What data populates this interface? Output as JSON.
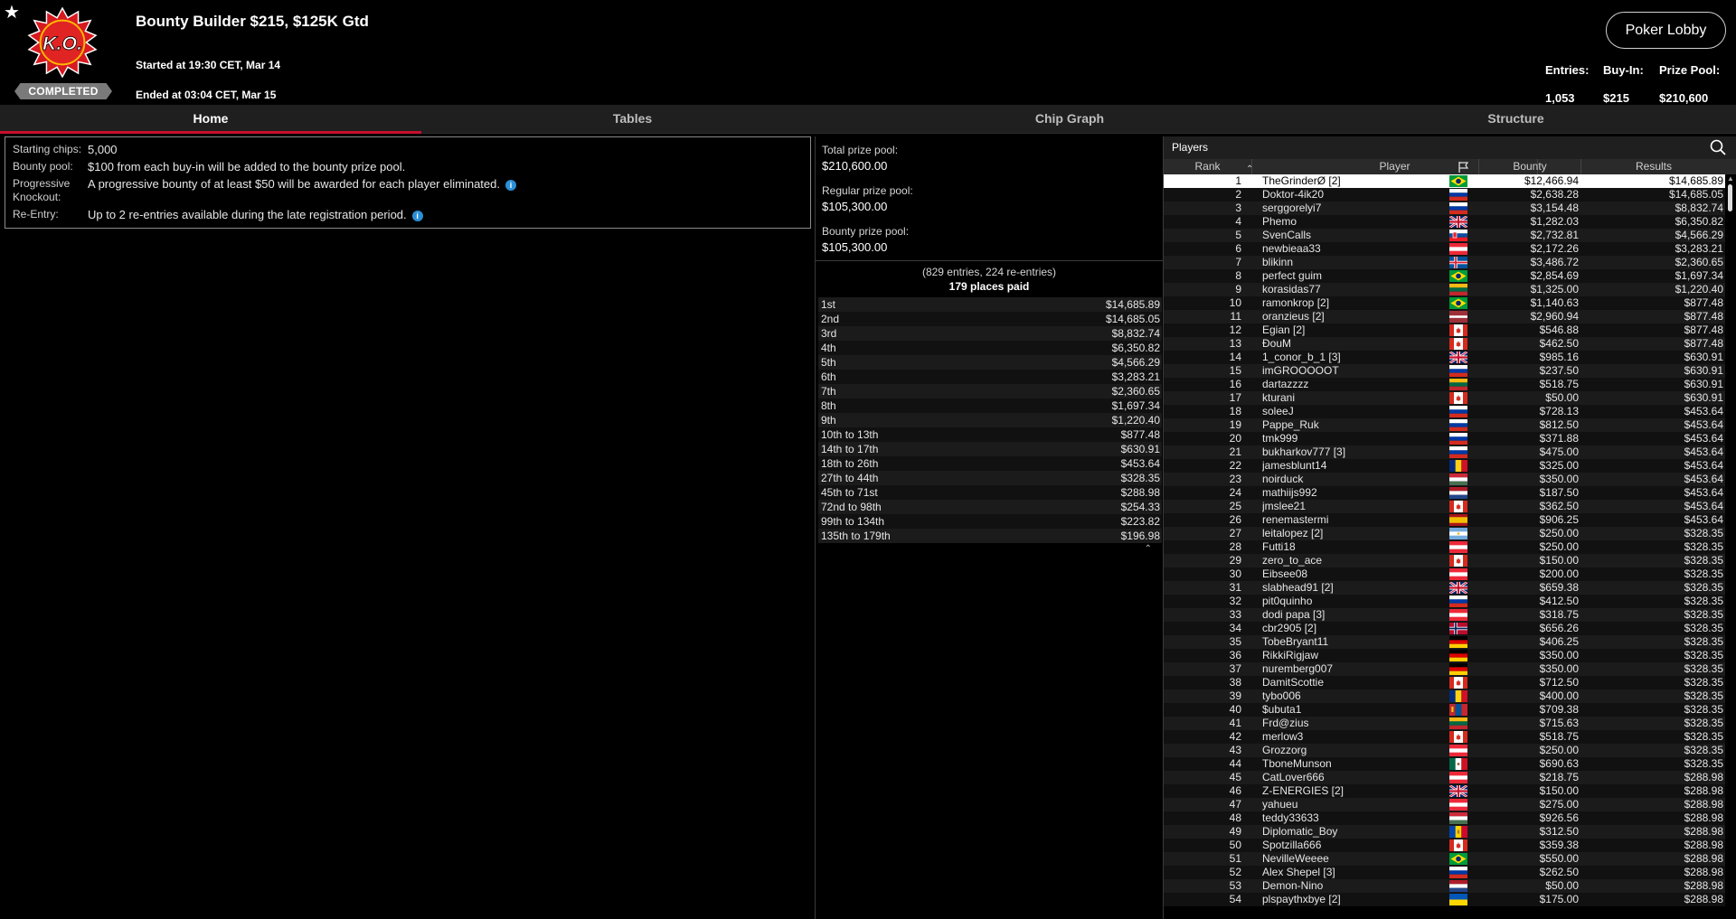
{
  "header": {
    "title": "Bounty Builder $215, $125K Gtd",
    "started": "Started at 19:30 CET, Mar 14",
    "ended": "Ended at 03:04 CET, Mar 15",
    "status": "COMPLETED",
    "ko_logo_text": "K.O.",
    "lobby_button": "Poker Lobby",
    "stats": {
      "entries_label": "Entries:",
      "entries_value": "1,053",
      "buyin_label": "Buy-In:",
      "buyin_value": "$215",
      "prize_label": "Prize Pool:",
      "prize_value": "$210,600"
    }
  },
  "tabs": [
    {
      "label": "Home",
      "active": true
    },
    {
      "label": "Tables",
      "active": false
    },
    {
      "label": "Chip Graph",
      "active": false
    },
    {
      "label": "Structure",
      "active": false
    }
  ],
  "info": {
    "starting_chips_label": "Starting chips:",
    "starting_chips_value": "5,000",
    "bounty_pool_label": "Bounty pool:",
    "bounty_pool_value": "$100 from each buy-in will be added to the bounty prize pool.",
    "progressive_label": "Progressive Knockout:",
    "progressive_value": "A progressive bounty of at least $50 will be awarded for each player eliminated.",
    "reentry_label": "Re-Entry:",
    "reentry_value": "Up to 2 re-entries available during the late registration period."
  },
  "prize_pool": {
    "total_label": "Total prize pool:",
    "total_value": "$210,600.00",
    "regular_label": "Regular prize pool:",
    "regular_value": "$105,300.00",
    "bounty_label": "Bounty prize pool:",
    "bounty_value": "$105,300.00",
    "entries_summary": "(829 entries, 224 re-entries)",
    "places_paid": "179 places paid",
    "payouts": [
      {
        "place": "1st",
        "amount": "$14,685.89"
      },
      {
        "place": "2nd",
        "amount": "$14,685.05"
      },
      {
        "place": "3rd",
        "amount": "$8,832.74"
      },
      {
        "place": "4th",
        "amount": "$6,350.82"
      },
      {
        "place": "5th",
        "amount": "$4,566.29"
      },
      {
        "place": "6th",
        "amount": "$3,283.21"
      },
      {
        "place": "7th",
        "amount": "$2,360.65"
      },
      {
        "place": "8th",
        "amount": "$1,697.34"
      },
      {
        "place": "9th",
        "amount": "$1,220.40"
      },
      {
        "place": "10th to 13th",
        "amount": "$877.48"
      },
      {
        "place": "14th to 17th",
        "amount": "$630.91"
      },
      {
        "place": "18th to 26th",
        "amount": "$453.64"
      },
      {
        "place": "27th to 44th",
        "amount": "$328.35"
      },
      {
        "place": "45th to 71st",
        "amount": "$288.98"
      },
      {
        "place": "72nd to 98th",
        "amount": "$254.33"
      },
      {
        "place": "99th to 134th",
        "amount": "$223.82"
      },
      {
        "place": "135th to 179th",
        "amount": "$196.98"
      }
    ]
  },
  "players": {
    "title": "Players",
    "columns": {
      "rank": "Rank",
      "player": "Player",
      "bounty": "Bounty",
      "results": "Results"
    },
    "rows": [
      {
        "rank": "1",
        "name": "TheGrinderØ [2]",
        "flag": "br",
        "bounty": "$12,466.94",
        "results": "$14,685.89"
      },
      {
        "rank": "2",
        "name": "Doktor-4ik20",
        "flag": "ru",
        "bounty": "$2,638.28",
        "results": "$14,685.05"
      },
      {
        "rank": "3",
        "name": "serggorelyi7",
        "flag": "ru",
        "bounty": "$3,154.48",
        "results": "$8,832.74"
      },
      {
        "rank": "4",
        "name": "Phemo",
        "flag": "gb",
        "bounty": "$1,282.03",
        "results": "$6,350.82"
      },
      {
        "rank": "5",
        "name": "SvenCalls",
        "flag": "sk",
        "bounty": "$2,732.81",
        "results": "$4,566.29"
      },
      {
        "rank": "6",
        "name": "newbieaa33",
        "flag": "at",
        "bounty": "$2,172.26",
        "results": "$3,283.21"
      },
      {
        "rank": "7",
        "name": "blikinn",
        "flag": "is",
        "bounty": "$3,486.72",
        "results": "$2,360.65"
      },
      {
        "rank": "8",
        "name": "perfect guim",
        "flag": "br",
        "bounty": "$2,854.69",
        "results": "$1,697.34"
      },
      {
        "rank": "9",
        "name": "korasidas77",
        "flag": "lt",
        "bounty": "$1,325.00",
        "results": "$1,220.40"
      },
      {
        "rank": "10",
        "name": "ramonkrop [2]",
        "flag": "br",
        "bounty": "$1,140.63",
        "results": "$877.48"
      },
      {
        "rank": "11",
        "name": "oranzieus [2]",
        "flag": "lv",
        "bounty": "$2,960.94",
        "results": "$877.48"
      },
      {
        "rank": "12",
        "name": "Egian [2]",
        "flag": "ca",
        "bounty": "$546.88",
        "results": "$877.48"
      },
      {
        "rank": "13",
        "name": "ĐouM",
        "flag": "ca",
        "bounty": "$462.50",
        "results": "$877.48"
      },
      {
        "rank": "14",
        "name": "1_conor_b_1 [3]",
        "flag": "gb",
        "bounty": "$985.16",
        "results": "$630.91"
      },
      {
        "rank": "15",
        "name": "imGROOOOOT",
        "flag": "ru",
        "bounty": "$237.50",
        "results": "$630.91"
      },
      {
        "rank": "16",
        "name": "dartazzzz",
        "flag": "lt",
        "bounty": "$518.75",
        "results": "$630.91"
      },
      {
        "rank": "17",
        "name": "kturani",
        "flag": "ca",
        "bounty": "$50.00",
        "results": "$630.91"
      },
      {
        "rank": "18",
        "name": "soleeJ",
        "flag": "ru",
        "bounty": "$728.13",
        "results": "$453.64"
      },
      {
        "rank": "19",
        "name": "Pappe_Ruk",
        "flag": "ru",
        "bounty": "$812.50",
        "results": "$453.64"
      },
      {
        "rank": "20",
        "name": "tmk999",
        "flag": "ru",
        "bounty": "$371.88",
        "results": "$453.64"
      },
      {
        "rank": "21",
        "name": "bukharkov777 [3]",
        "flag": "ru",
        "bounty": "$475.00",
        "results": "$453.64"
      },
      {
        "rank": "22",
        "name": "jamesblunt14",
        "flag": "ro",
        "bounty": "$325.00",
        "results": "$453.64"
      },
      {
        "rank": "23",
        "name": "noirduck",
        "flag": "hu",
        "bounty": "$350.00",
        "results": "$453.64"
      },
      {
        "rank": "24",
        "name": "mathiijs992",
        "flag": "nl",
        "bounty": "$187.50",
        "results": "$453.64"
      },
      {
        "rank": "25",
        "name": "jmslee21",
        "flag": "ca",
        "bounty": "$362.50",
        "results": "$453.64"
      },
      {
        "rank": "26",
        "name": "renemastermi",
        "flag": "es",
        "bounty": "$906.25",
        "results": "$453.64"
      },
      {
        "rank": "27",
        "name": "leitalopez [2]",
        "flag": "ar",
        "bounty": "$250.00",
        "results": "$328.35"
      },
      {
        "rank": "28",
        "name": "Futti18",
        "flag": "at",
        "bounty": "$250.00",
        "results": "$328.35"
      },
      {
        "rank": "29",
        "name": "zero_to_ace",
        "flag": "ca",
        "bounty": "$150.00",
        "results": "$328.35"
      },
      {
        "rank": "30",
        "name": "Eibsee08",
        "flag": "at",
        "bounty": "$200.00",
        "results": "$328.35"
      },
      {
        "rank": "31",
        "name": "slabhead91 [2]",
        "flag": "gb",
        "bounty": "$659.38",
        "results": "$328.35"
      },
      {
        "rank": "32",
        "name": "pit0quinho",
        "flag": "ru",
        "bounty": "$412.50",
        "results": "$328.35"
      },
      {
        "rank": "33",
        "name": "dodi papa [3]",
        "flag": "at",
        "bounty": "$318.75",
        "results": "$328.35"
      },
      {
        "rank": "34",
        "name": "cbr2905 [2]",
        "flag": "no",
        "bounty": "$656.26",
        "results": "$328.35"
      },
      {
        "rank": "35",
        "name": "TobeBryant11",
        "flag": "de",
        "bounty": "$406.25",
        "results": "$328.35"
      },
      {
        "rank": "36",
        "name": "RikkiRigjaw",
        "flag": "de",
        "bounty": "$350.00",
        "results": "$328.35"
      },
      {
        "rank": "37",
        "name": "nuremberg007",
        "flag": "de",
        "bounty": "$350.00",
        "results": "$328.35"
      },
      {
        "rank": "38",
        "name": "DamitScottie",
        "flag": "ca",
        "bounty": "$712.50",
        "results": "$328.35"
      },
      {
        "rank": "39",
        "name": "tybo006",
        "flag": "ro",
        "bounty": "$400.00",
        "results": "$328.35"
      },
      {
        "rank": "40",
        "name": "$ubuta1",
        "flag": "mn",
        "bounty": "$709.38",
        "results": "$328.35"
      },
      {
        "rank": "41",
        "name": "Frd@zius",
        "flag": "lt",
        "bounty": "$715.63",
        "results": "$328.35"
      },
      {
        "rank": "42",
        "name": "merlow3",
        "flag": "ca",
        "bounty": "$518.75",
        "results": "$328.35"
      },
      {
        "rank": "43",
        "name": "Grozzorg",
        "flag": "at",
        "bounty": "$250.00",
        "results": "$328.35"
      },
      {
        "rank": "44",
        "name": "TboneMunson",
        "flag": "mx",
        "bounty": "$690.63",
        "results": "$328.35"
      },
      {
        "rank": "45",
        "name": "CatLover666",
        "flag": "at",
        "bounty": "$218.75",
        "results": "$288.98"
      },
      {
        "rank": "46",
        "name": "Z-ENERGIES [2]",
        "flag": "gb",
        "bounty": "$150.00",
        "results": "$288.98"
      },
      {
        "rank": "47",
        "name": "yahueu",
        "flag": "at",
        "bounty": "$275.00",
        "results": "$288.98"
      },
      {
        "rank": "48",
        "name": "teddy33633",
        "flag": "hu",
        "bounty": "$926.56",
        "results": "$288.98"
      },
      {
        "rank": "49",
        "name": "Diplomatic_Boy",
        "flag": "md",
        "bounty": "$312.50",
        "results": "$288.98"
      },
      {
        "rank": "50",
        "name": "Spotzilla666",
        "flag": "ca",
        "bounty": "$359.38",
        "results": "$288.98"
      },
      {
        "rank": "51",
        "name": "NevilleWeeee",
        "flag": "br",
        "bounty": "$550.00",
        "results": "$288.98"
      },
      {
        "rank": "52",
        "name": "Alex Shepel [3]",
        "flag": "ru",
        "bounty": "$262.50",
        "results": "$288.98"
      },
      {
        "rank": "53",
        "name": "Demon-Nino",
        "flag": "nl",
        "bounty": "$50.00",
        "results": "$288.98"
      },
      {
        "rank": "54",
        "name": "plspaythxbye [2]",
        "flag": "ua",
        "bounty": "$175.00",
        "results": "$288.98"
      }
    ]
  }
}
